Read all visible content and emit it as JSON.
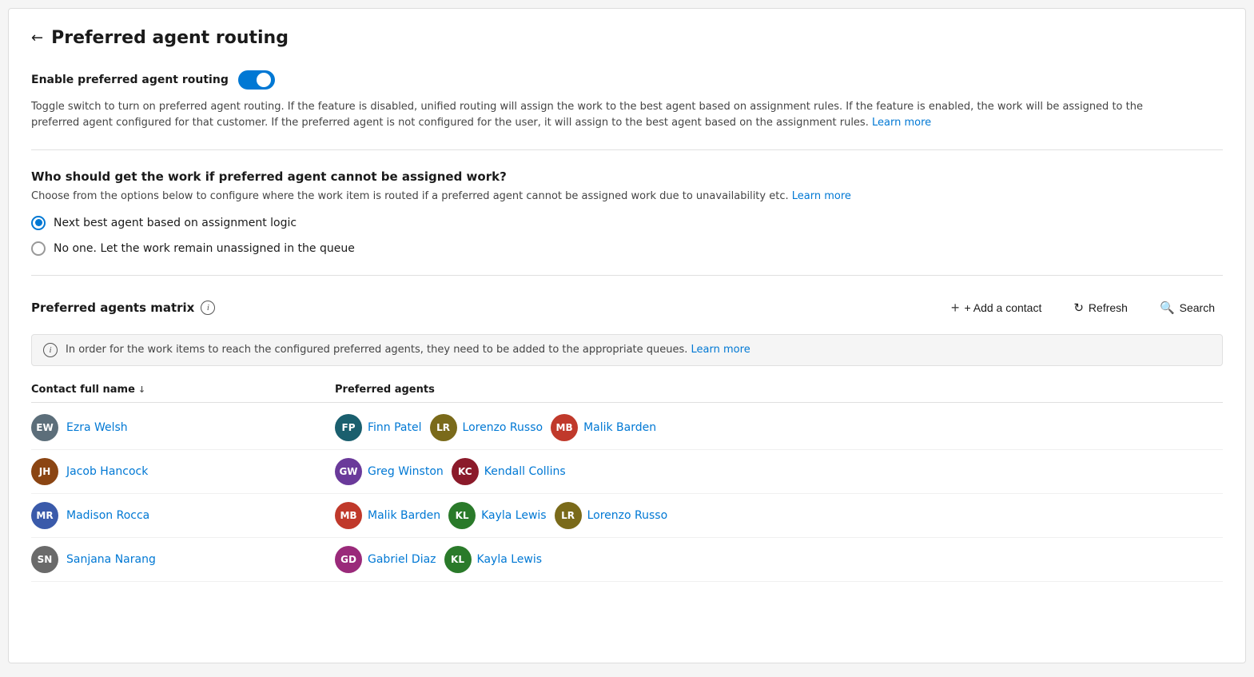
{
  "page": {
    "title": "Preferred agent routing",
    "back_label": "←"
  },
  "toggle": {
    "label": "Enable preferred agent routing",
    "enabled": true,
    "description": "Toggle switch to turn on preferred agent routing. If the feature is disabled, unified routing will assign the work to the best agent based on assignment rules. If the feature is enabled, the work will be assigned to the preferred agent configured for that customer. If the preferred agent is not configured for the user, it will assign to the best agent based on the assignment rules.",
    "learn_more": "Learn more"
  },
  "fallback": {
    "heading": "Who should get the work if preferred agent cannot be assigned work?",
    "description": "Choose from the options below to configure where the work item is routed if a preferred agent cannot be assigned work due to unavailability etc.",
    "learn_more": "Learn more",
    "options": [
      {
        "id": "next_best",
        "label": "Next best agent based on assignment logic",
        "selected": true
      },
      {
        "id": "no_one",
        "label": "No one. Let the work remain unassigned in the queue",
        "selected": false
      }
    ]
  },
  "matrix": {
    "title": "Preferred agents matrix",
    "info_icon": "i",
    "add_contact_label": "+ Add a contact",
    "refresh_label": "Refresh",
    "search_label": "Search",
    "banner_text": "In order for the work items to reach the configured preferred agents, they need to be added to the appropriate queues.",
    "banner_learn_more": "Learn more",
    "columns": [
      {
        "label": "Contact full name",
        "sortable": true
      },
      {
        "label": "Preferred agents",
        "sortable": false
      }
    ],
    "rows": [
      {
        "contact": {
          "name": "Ezra Welsh",
          "initials": "EW",
          "color": "#5c6e7a"
        },
        "agents": [
          {
            "name": "Finn Patel",
            "initials": "FP",
            "color": "#1a5f6e"
          },
          {
            "name": "Lorenzo Russo",
            "initials": "LR",
            "color": "#7a6a1a"
          },
          {
            "name": "Malik Barden",
            "initials": "MB",
            "color": "#c0392b"
          }
        ]
      },
      {
        "contact": {
          "name": "Jacob Hancock",
          "initials": "JH",
          "color": "#8b4513"
        },
        "agents": [
          {
            "name": "Greg Winston",
            "initials": "GW",
            "color": "#6a3a9a"
          },
          {
            "name": "Kendall Collins",
            "initials": "KC",
            "color": "#8b1a2a"
          }
        ]
      },
      {
        "contact": {
          "name": "Madison Rocca",
          "initials": "MR",
          "color": "#3a5aaa"
        },
        "agents": [
          {
            "name": "Malik Barden",
            "initials": "MB",
            "color": "#c0392b"
          },
          {
            "name": "Kayla Lewis",
            "initials": "KL",
            "color": "#2a7a2a"
          },
          {
            "name": "Lorenzo Russo",
            "initials": "LR",
            "color": "#7a6a1a"
          }
        ]
      },
      {
        "contact": {
          "name": "Sanjana Narang",
          "initials": "SN",
          "color": "#6a6a6a"
        },
        "agents": [
          {
            "name": "Gabriel Diaz",
            "initials": "GD",
            "color": "#9a2a7a"
          },
          {
            "name": "Kayla Lewis",
            "initials": "KL",
            "color": "#2a7a2a"
          }
        ]
      }
    ]
  }
}
